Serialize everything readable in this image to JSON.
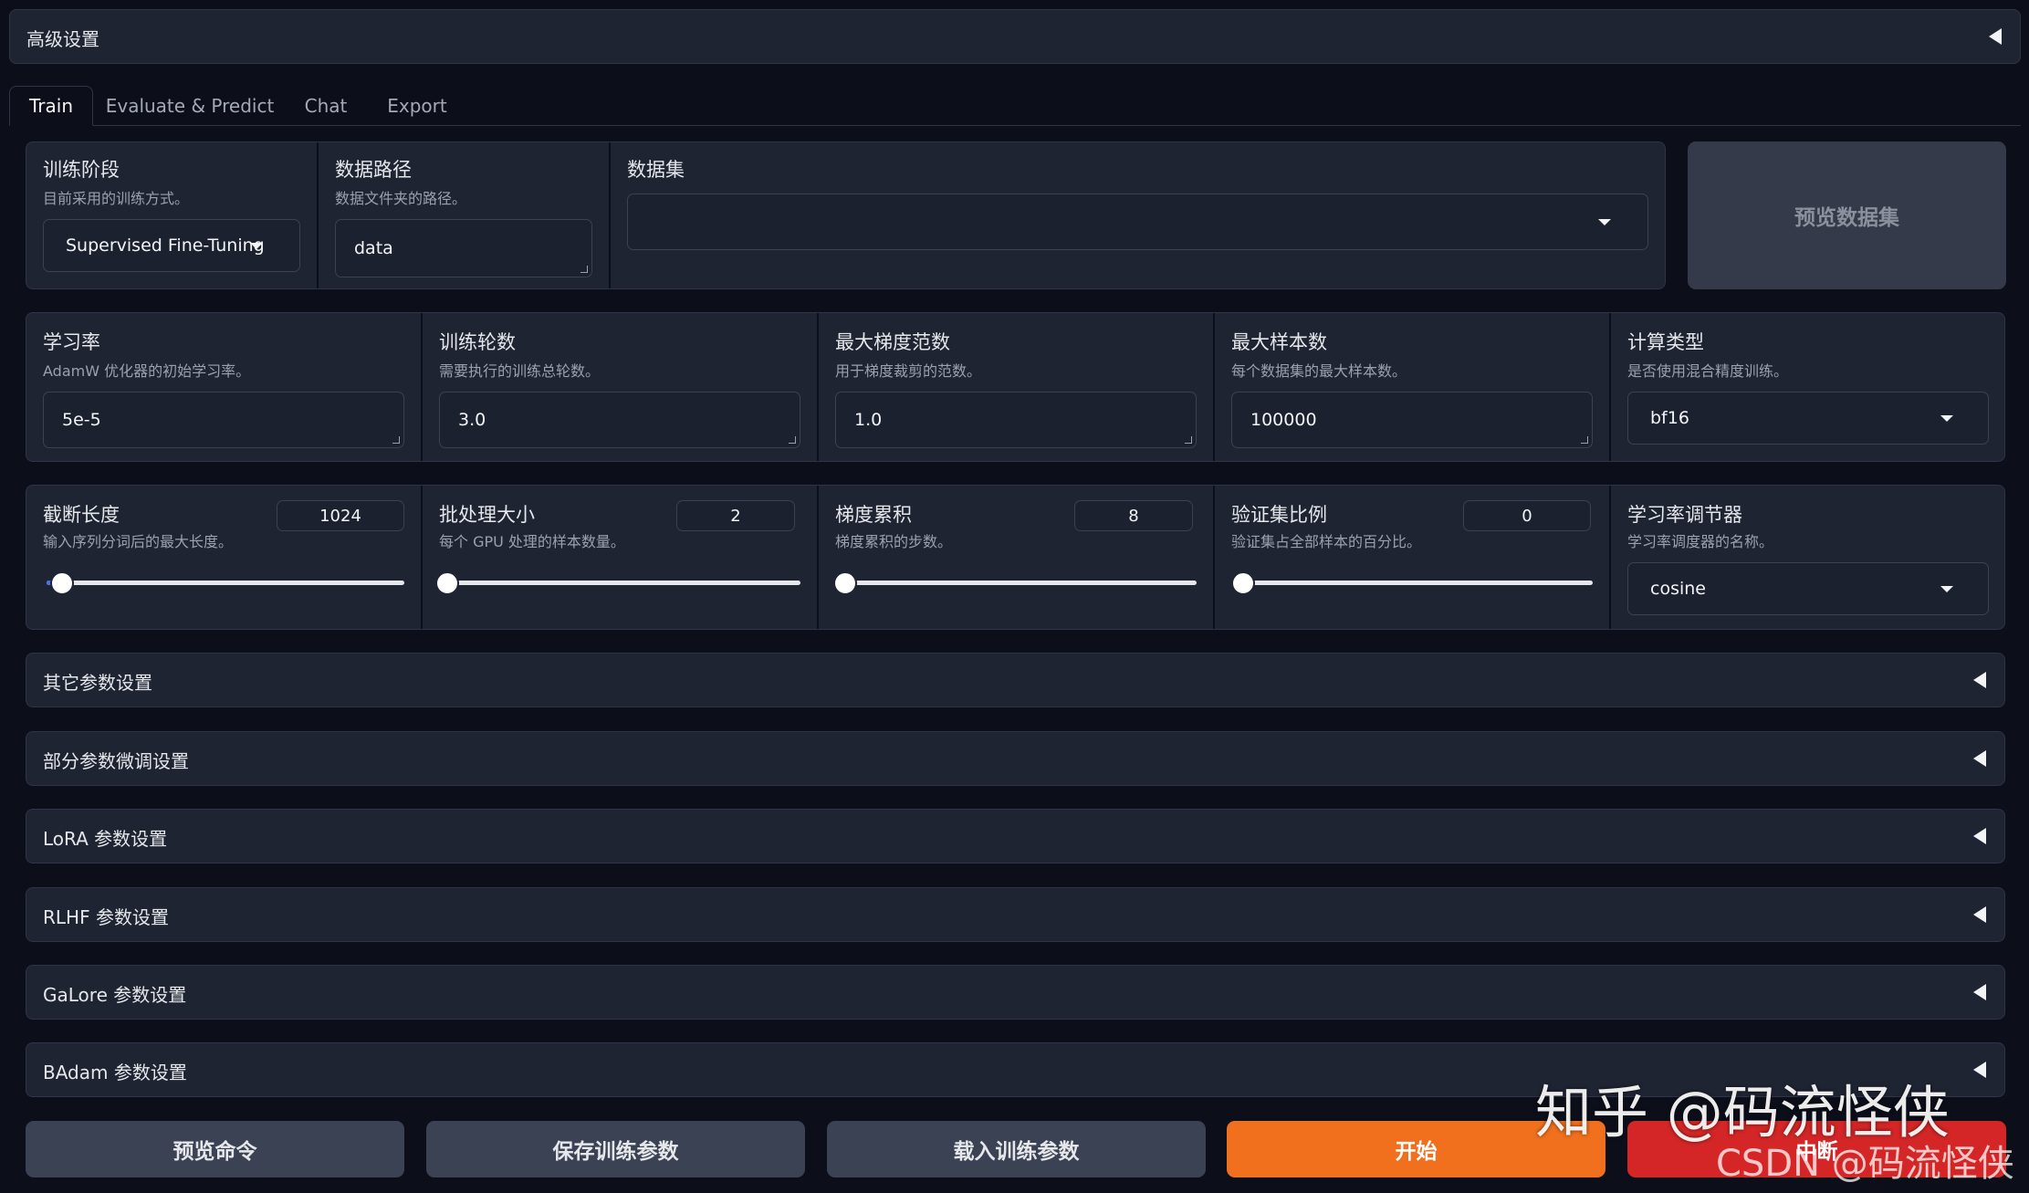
{
  "advanced": {
    "title": "高级设置"
  },
  "tabs": [
    {
      "label": "Train",
      "active": true
    },
    {
      "label": "Evaluate & Predict"
    },
    {
      "label": "Chat"
    },
    {
      "label": "Export"
    }
  ],
  "stage": {
    "label": "训练阶段",
    "desc": "目前采用的训练方式。",
    "value": "Supervised Fine-Tuning"
  },
  "dataset_dir": {
    "label": "数据路径",
    "desc": "数据文件夹的路径。",
    "value": "data"
  },
  "dataset": {
    "label": "数据集",
    "value": ""
  },
  "preview_dataset_button": "预览数据集",
  "params": {
    "learning_rate": {
      "label": "学习率",
      "desc": "AdamW 优化器的初始学习率。",
      "value": "5e-5"
    },
    "epochs": {
      "label": "训练轮数",
      "desc": "需要执行的训练总轮数。",
      "value": "3.0"
    },
    "max_grad_norm": {
      "label": "最大梯度范数",
      "desc": "用于梯度裁剪的范数。",
      "value": "1.0"
    },
    "max_samples": {
      "label": "最大样本数",
      "desc": "每个数据集的最大样本数。",
      "value": "100000"
    },
    "compute_type": {
      "label": "计算类型",
      "desc": "是否使用混合精度训练。",
      "value": "bf16"
    }
  },
  "sliders": {
    "cutoff_len": {
      "label": "截断长度",
      "desc": "输入序列分词后的最大长度。",
      "value": "1024"
    },
    "batch_size": {
      "label": "批处理大小",
      "desc": "每个 GPU 处理的样本数量。",
      "value": "2"
    },
    "grad_accum": {
      "label": "梯度累积",
      "desc": "梯度累积的步数。",
      "value": "8"
    },
    "val_size": {
      "label": "验证集比例",
      "desc": "验证集占全部样本的百分比。",
      "value": "0"
    },
    "lr_scheduler": {
      "label": "学习率调节器",
      "desc": "学习率调度器的名称。",
      "value": "cosine"
    }
  },
  "accordions": [
    {
      "label": "其它参数设置"
    },
    {
      "label": "部分参数微调设置"
    },
    {
      "label": "LoRA 参数设置"
    },
    {
      "label": "RLHF 参数设置"
    },
    {
      "label": "GaLore 参数设置"
    },
    {
      "label": "BAdam 参数设置"
    }
  ],
  "buttons": {
    "preview_cmd": "预览命令",
    "save_args": "保存训练参数",
    "load_args": "载入训练参数",
    "start": "开始",
    "abort": "中断"
  },
  "watermark": {
    "main": "知乎 @码流怪侠",
    "sub": "CSDN @码流怪侠"
  },
  "colors": {
    "start": "#f0701e",
    "abort": "#d42626",
    "secondary": "#3b4254",
    "panel": "#1f2433",
    "background": "#0c0f1a"
  }
}
